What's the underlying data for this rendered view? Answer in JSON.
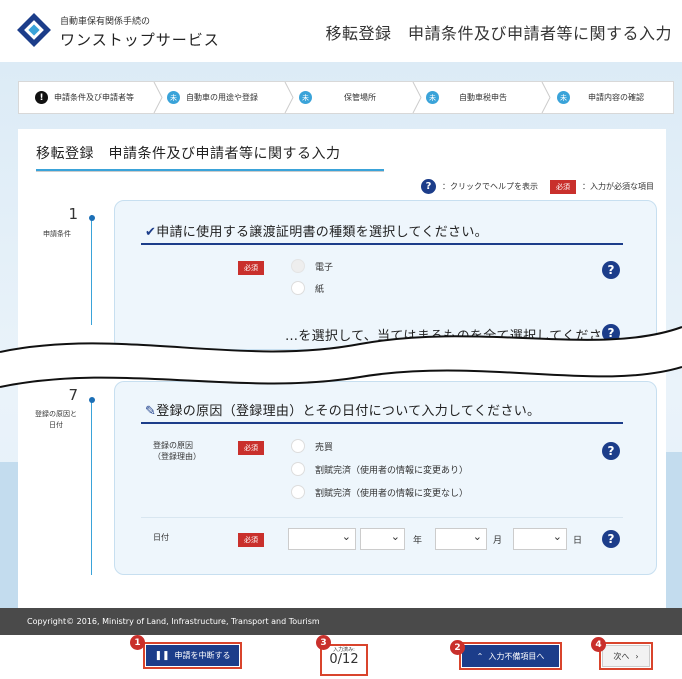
{
  "header": {
    "logo_sub": "自動車保有関係手続の",
    "logo_main": "ワンストップサービス",
    "page_title": "移転登録　申請条件及び申請者等に関する入力"
  },
  "steps": [
    {
      "badge": "!",
      "label": "申請条件及び申請者等",
      "current": true
    },
    {
      "badge": "未",
      "label": "自動車の用途や登録",
      "current": false
    },
    {
      "badge": "未",
      "label": "保管場所",
      "current": false
    },
    {
      "badge": "未",
      "label": "自動車税申告",
      "current": false
    },
    {
      "badge": "未",
      "label": "申請内容の確認",
      "current": false
    }
  ],
  "panel": {
    "title": "移転登録　申請条件及び申請者等に関する入力",
    "help_legend": "：クリックでヘルプを表示",
    "required_badge": "必須",
    "required_legend": "：入力が必須な項目"
  },
  "section1": {
    "number": "1",
    "label": "申請条件",
    "question": "申請に使用する譲渡証明書の種類を選択してください。",
    "options": [
      "電子",
      "紙"
    ],
    "next_question_partial": "…を選択して、当てはまるものを全て選択してください。"
  },
  "section7": {
    "number": "7",
    "label": "登録の原因と日付",
    "question": "登録の原因（登録理由）とその日付について入力してください。",
    "reason_label": "登録の原因\n（登録理由）",
    "reason_options": [
      "売買",
      "割賦完済（使用者の情報に変更あり）",
      "割賦完済（使用者の情報に変更なし）"
    ],
    "date_label": "日付",
    "year_unit": "年",
    "month_unit": "月",
    "day_unit": "日"
  },
  "footer": {
    "copyright": "Copyright© 2016, Ministry of Land, Infrastructure, Transport and Tourism"
  },
  "bottom": {
    "suspend_label": "申請を中断する",
    "progress_label": "入力済み:",
    "progress_value": "0/12",
    "missing_label": "入力不備項目へ",
    "next_label": "次へ",
    "markers": [
      "1",
      "3",
      "2",
      "4"
    ]
  },
  "colors": {
    "navy": "#1c3d8a",
    "accent_blue": "#3aa3d9",
    "required_red": "#c9302c",
    "footer_gray": "#4a4a4a"
  }
}
